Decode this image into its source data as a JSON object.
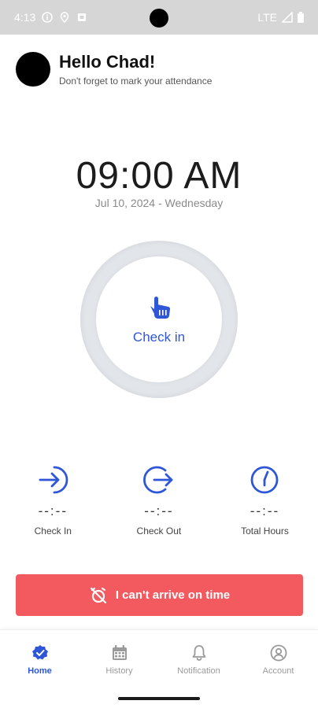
{
  "status_bar": {
    "time": "4:13",
    "network": "LTE"
  },
  "header": {
    "greeting": "Hello Chad!",
    "subtitle": "Don't forget to mark your attendance"
  },
  "clock": {
    "time": "09:00 AM",
    "date": "Jul 10, 2024 - Wednesday"
  },
  "checkin": {
    "label": "Check in",
    "icon": "pointer-hand-icon"
  },
  "stats": [
    {
      "icon": "check-in-arrow-icon",
      "value": "--:--",
      "label": "Check In"
    },
    {
      "icon": "check-out-arrow-icon",
      "value": "--:--",
      "label": "Check Out"
    },
    {
      "icon": "clock-icon",
      "value": "--:--",
      "label": "Total Hours"
    }
  ],
  "late_button": {
    "label": "I can't arrive on time",
    "icon": "late-alarm-icon"
  },
  "nav": {
    "items": [
      {
        "label": "Home",
        "icon": "home-badge-icon",
        "active": true
      },
      {
        "label": "History",
        "icon": "calendar-icon",
        "active": false
      },
      {
        "label": "Notification",
        "icon": "bell-icon",
        "active": false
      },
      {
        "label": "Account",
        "icon": "account-icon",
        "active": false
      }
    ]
  },
  "colors": {
    "accent": "#2f56d6",
    "danger": "#f25a5f",
    "muted": "#9a9a9a"
  }
}
